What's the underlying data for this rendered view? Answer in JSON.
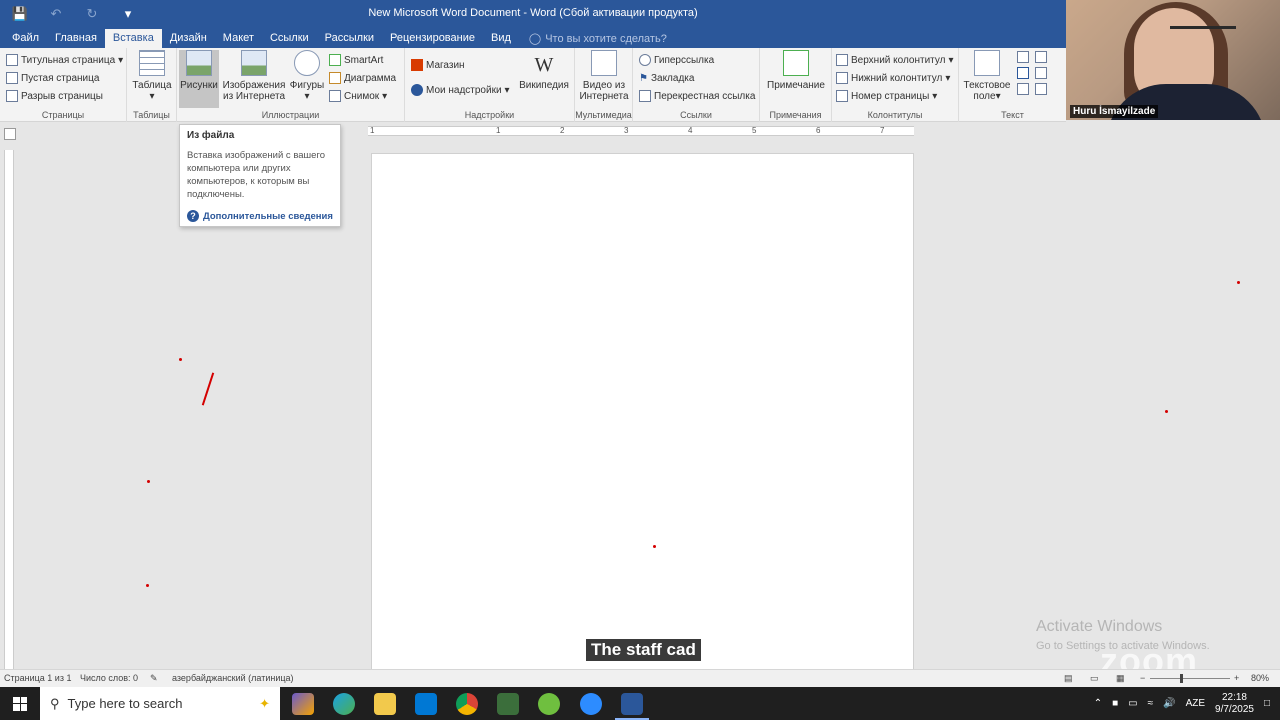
{
  "window": {
    "title": "New Microsoft Word Document - Word (Сбой активации продукта)"
  },
  "tabs": [
    "Файл",
    "Главная",
    "Вставка",
    "Дизайн",
    "Макет",
    "Ссылки",
    "Рассылки",
    "Рецензирование",
    "Вид"
  ],
  "active_tab": "Вставка",
  "tell_me": "Что вы хотите сделать?",
  "ribbon": {
    "pages": {
      "items": [
        "Титульная страница",
        "Пустая страница",
        "Разрыв страницы"
      ],
      "label": "Страницы"
    },
    "tables": {
      "button": "Таблица",
      "label": "Таблицы"
    },
    "illustrations": {
      "pictures": "Рисунки",
      "online_pictures_line1": "Изображения",
      "online_pictures_line2": "из Интернета",
      "shapes": "Фигуры",
      "smartart": "SmartArt",
      "chart": "Диаграмма",
      "screenshot": "Снимок",
      "label": "Иллюстрации"
    },
    "addins": {
      "store": "Магазин",
      "my_addins": "Мои надстройки",
      "wikipedia": "Википедия",
      "label": "Надстройки"
    },
    "media": {
      "video_line1": "Видео из",
      "video_line2": "Интернета",
      "label": "Мультимедиа"
    },
    "links": {
      "items": [
        "Гиперссылка",
        "Закладка",
        "Перекрестная ссылка"
      ],
      "label": "Ссылки"
    },
    "comments": {
      "button": "Примечание",
      "label": "Примечания"
    },
    "header_footer": {
      "items": [
        "Верхний колонтитул",
        "Нижний колонтитул",
        "Номер страницы"
      ],
      "label": "Колонтитулы"
    },
    "text": {
      "textbox_line1": "Текстовое",
      "textbox_line2": "поле",
      "label": "Текст"
    }
  },
  "tooltip": {
    "title": "Из файла",
    "description": "Вставка изображений с вашего компьютера или других компьютеров, к которым вы подключены.",
    "link": "Дополнительные сведения"
  },
  "ruler_numbers": [
    "1",
    "1",
    "2",
    "3",
    "4",
    "5",
    "6",
    "7"
  ],
  "webcam": {
    "name": "Huru İsmayilzade"
  },
  "caption": "The staff cad",
  "activate": {
    "line1": "Activate Windows",
    "line2": "Go to Settings to activate Windows."
  },
  "watermark": "zoom",
  "status": {
    "page": "Страница 1 из 1",
    "words": "Число слов: 0",
    "language": "азербайджанский (латиница)",
    "zoom": "80%"
  },
  "taskbar": {
    "search_placeholder": "Type here to search",
    "lang": "AZE",
    "time": "22:18",
    "date": "9/7/2025"
  },
  "colors": {
    "accent": "#2b579a",
    "annotation": "#d40000"
  }
}
